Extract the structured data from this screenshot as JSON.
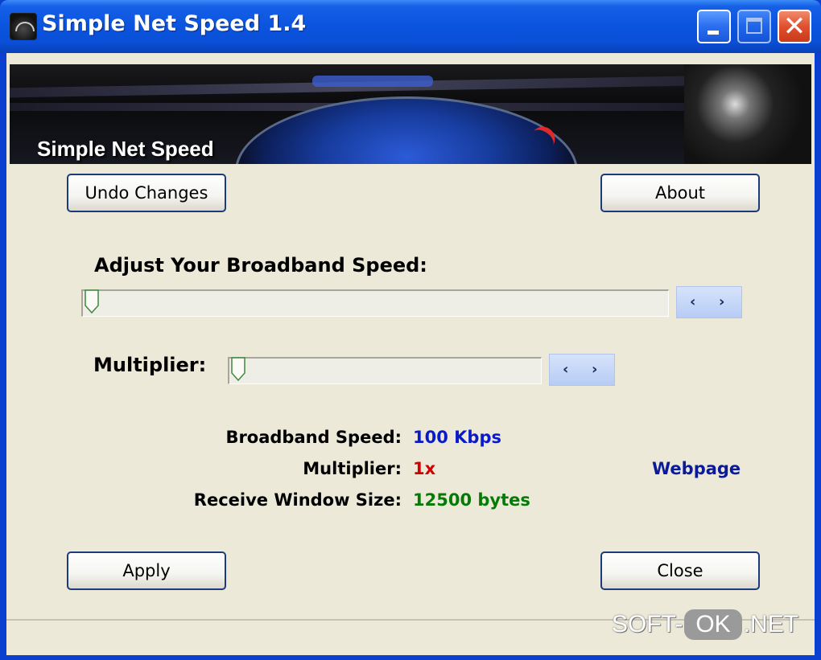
{
  "window": {
    "title": "Simple Net Speed 1.4",
    "controls": {
      "minimize": "minimize",
      "maximize": "maximize",
      "close": "close"
    }
  },
  "banner": {
    "title": "Simple Net Speed"
  },
  "buttons": {
    "undo": "Undo Changes",
    "about": "About",
    "apply": "Apply",
    "close": "Close"
  },
  "speed": {
    "label": "Adjust Your Broadband Speed:",
    "slider_position": 0
  },
  "multiplier": {
    "label": "Multiplier:",
    "slider_position": 0
  },
  "info": {
    "broadband_label": "Broadband Speed:",
    "broadband_value": "100 Kbps",
    "multiplier_label": "Multiplier:",
    "multiplier_value": "1x",
    "rwin_label": "Receive Window Size:",
    "rwin_value": "12500 bytes",
    "webpage_link": "Webpage"
  },
  "colors": {
    "titlebar": "#0a4fd6",
    "value_blue": "#0a1ac8",
    "value_red": "#d40000",
    "value_green": "#067a06"
  },
  "watermark": {
    "part1": "SOFT-",
    "part2": "OK",
    "part3": ".NET"
  }
}
